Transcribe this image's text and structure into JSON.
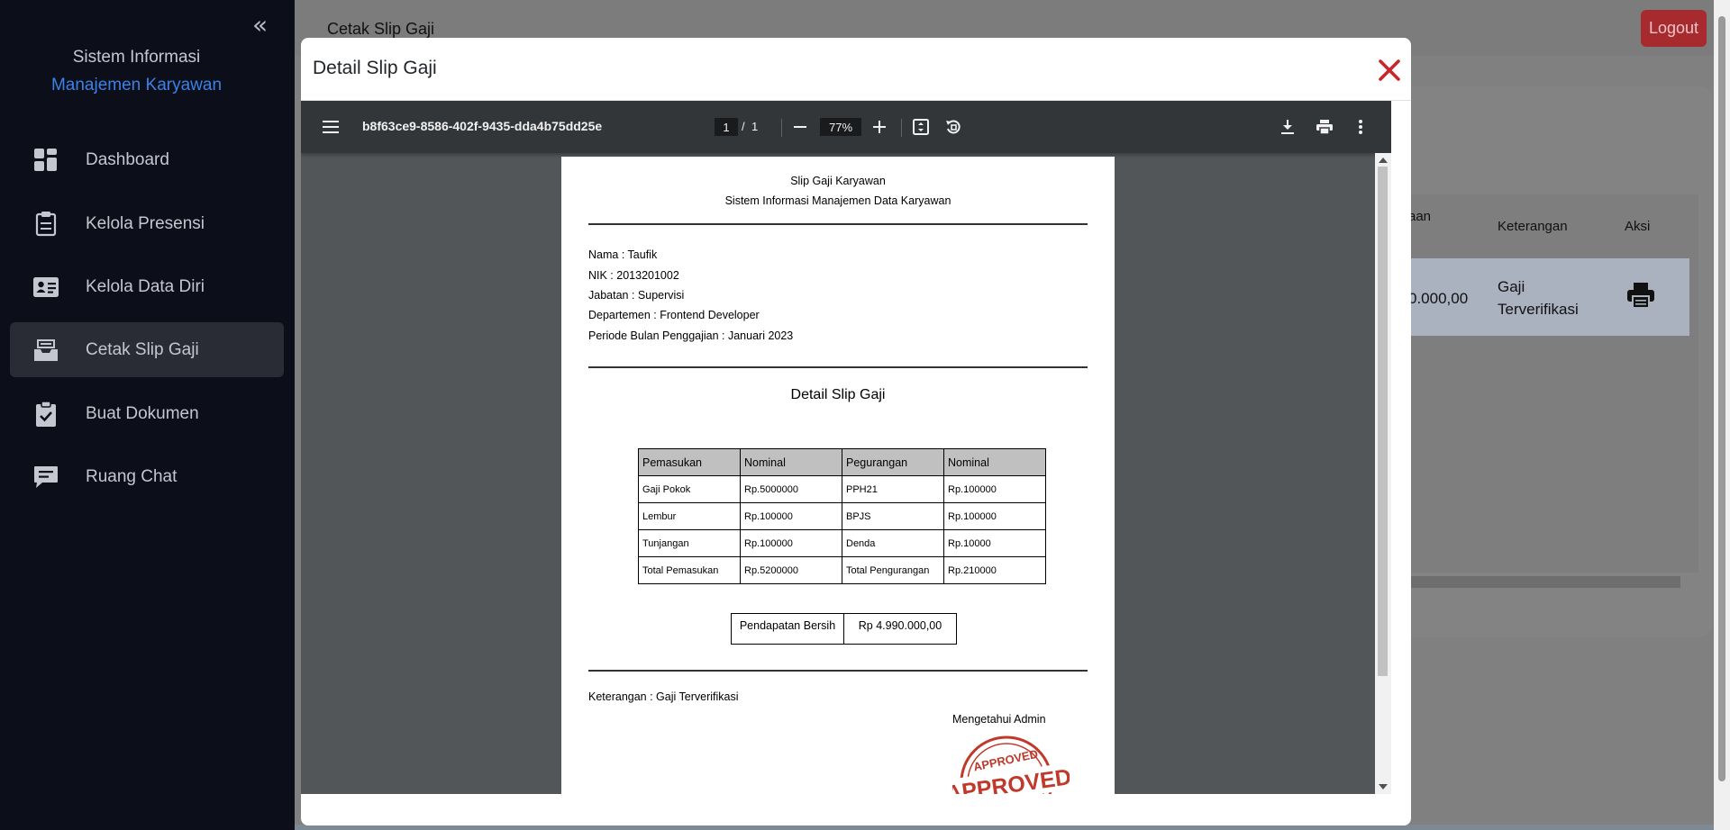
{
  "sidebar": {
    "brand_line1": "Sistem Informasi",
    "brand_line2": "Manajemen Karyawan",
    "items": [
      {
        "label": "Dashboard",
        "icon": "dashboard-icon"
      },
      {
        "label": "Kelola Presensi",
        "icon": "clipboard-icon"
      },
      {
        "label": "Kelola Data Diri",
        "icon": "id-card-icon"
      },
      {
        "label": "Cetak Slip Gaji",
        "icon": "inbox-icon",
        "active": true
      },
      {
        "label": "Buat Dokumen",
        "icon": "clipboard-check-icon"
      },
      {
        "label": "Ruang Chat",
        "icon": "chat-icon"
      }
    ]
  },
  "topbar": {
    "title": "Cetak Slip Gaji",
    "logout_label": "Logout"
  },
  "background_table": {
    "headers": [
      "aan",
      "Keterangan",
      "Aksi"
    ],
    "row": {
      "amount": "0.000,00",
      "keterangan_l1": "Gaji",
      "keterangan_l2": "Terverifikasi"
    }
  },
  "modal": {
    "title": "Detail Slip Gaji",
    "viewer": {
      "filename": "b8f63ce9-8586-402f-9435-dda4b75dd25e",
      "page_current": "1",
      "page_separator": "/",
      "page_total": "1",
      "zoom": "77%"
    },
    "document": {
      "title": "Slip Gaji Karyawan",
      "subtitle": "Sistem Informasi Manajemen Data Karyawan",
      "nama": "Nama : Taufik",
      "nik": "NIK : 2013201002",
      "jabatan": "Jabatan : Supervisi",
      "departemen": "Departemen : Frontend Developer",
      "periode": "Periode Bulan Penggajian : Januari 2023",
      "section_title": "Detail Slip Gaji",
      "table": {
        "headers": [
          "Pemasukan",
          "Nominal",
          "Pegurangan",
          "Nominal"
        ],
        "rows": [
          [
            "Gaji Pokok",
            "Rp.5000000",
            "PPH21",
            "Rp.100000"
          ],
          [
            "Lembur",
            "Rp.100000",
            "BPJS",
            "Rp.100000"
          ],
          [
            "Tunjangan",
            "Rp.100000",
            "Denda",
            "Rp.10000"
          ],
          [
            "Total Pemasukan",
            "Rp.5200000",
            "Total Pengurangan",
            "Rp.210000"
          ]
        ]
      },
      "net_label": "Pendapatan Bersih",
      "net_value": "Rp 4.990.000,00",
      "keterangan": "Keterangan : Gaji Terverifikasi",
      "mengetahui": "Mengetahui Admin",
      "stamp_text": "APPROVED"
    }
  },
  "colors": {
    "accent": "#3b82e6",
    "danger": "#c9252b",
    "sidebar_bg": "#0c0e1a",
    "active_item": "#2a2c35"
  }
}
